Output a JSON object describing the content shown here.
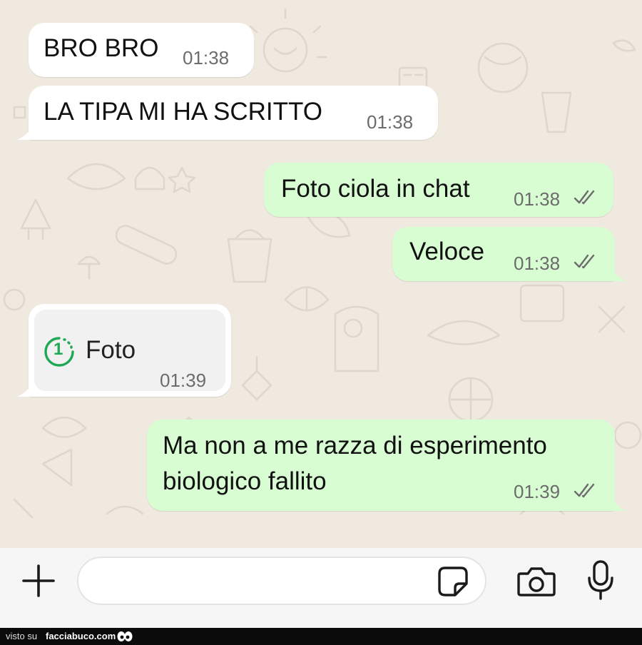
{
  "messages": [
    {
      "direction": "incoming",
      "text": "BRO BRO",
      "time": "01:38"
    },
    {
      "direction": "incoming",
      "text": "LA TIPA MI HA SCRITTO",
      "time": "01:38"
    },
    {
      "direction": "outgoing",
      "text": "Foto ciola in chat",
      "time": "01:38",
      "status": "read"
    },
    {
      "direction": "outgoing",
      "text": "Veloce",
      "time": "01:38",
      "status": "read"
    },
    {
      "direction": "incoming",
      "type": "view-once-photo",
      "label": "Foto",
      "badge": "1",
      "time": "01:39"
    },
    {
      "direction": "outgoing",
      "text_line1": "Ma non a me razza di esperimento",
      "text_line2": "biologico fallito",
      "time": "01:39",
      "status": "read"
    }
  ],
  "composer": {
    "placeholder": "",
    "icons": [
      "plus-icon",
      "sticker-icon",
      "camera-icon",
      "microphone-icon"
    ]
  },
  "footer": {
    "visto_su": "visto su",
    "site": "facciabuco.com"
  },
  "colors": {
    "outgoing_bubble": "#d9fdd3",
    "incoming_bubble": "#ffffff",
    "chat_background": "#efe9e0",
    "accent_green": "#1fa855",
    "ticks": "#6c6c6c",
    "footer_bg": "#0b0b0b"
  }
}
